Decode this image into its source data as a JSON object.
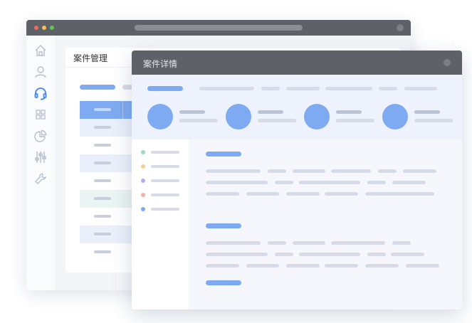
{
  "back_window": {
    "panel_title": "案件管理",
    "sidebar_icons": [
      "home-icon",
      "user-icon",
      "headset-icon",
      "grid-icon",
      "pie-chart-icon",
      "sliders-icon",
      "wrench-icon"
    ],
    "active_icon": "headset-icon"
  },
  "front_window": {
    "title": "案件详情",
    "list_dot_colors": [
      "#9fd7c2",
      "#f2d09a",
      "#b7a9ee",
      "#f3b0a6",
      "#7eaaf2"
    ]
  },
  "colors": {
    "titlebar": "#5e6167",
    "accent": "#7eaaf2",
    "placeholder": "#d6dce7",
    "traffic_red": "#ee6a5f",
    "traffic_yellow": "#f5be4f",
    "traffic_green": "#62c454"
  }
}
